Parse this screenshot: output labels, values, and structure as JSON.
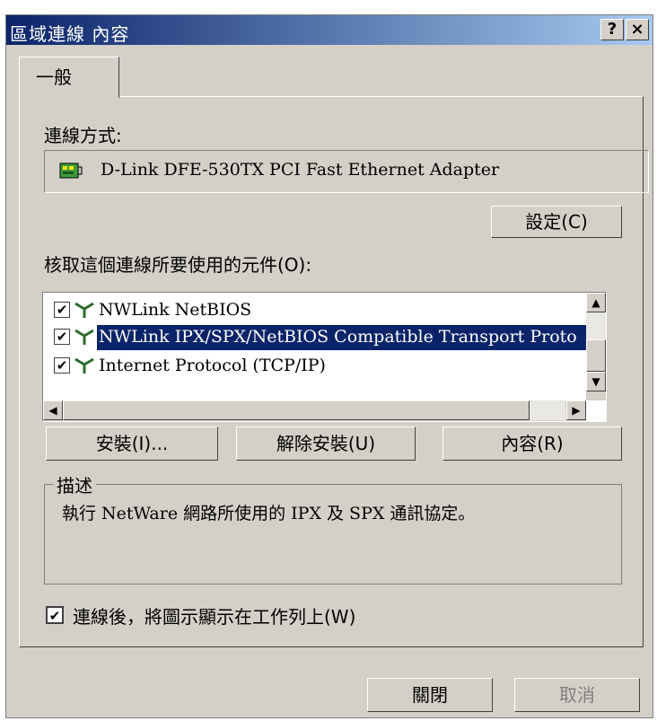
{
  "window": {
    "title": "區域連線 內容",
    "help_btn": "?",
    "close_btn": "×"
  },
  "tabs": [
    {
      "label": "一般"
    }
  ],
  "connect": {
    "label": "連線方式:",
    "adapter": "D-Link DFE-530TX PCI Fast Ethernet Adapter",
    "configure_btn": "設定(C)"
  },
  "components": {
    "label": "核取這個連線所要使用的元件(O):",
    "items": [
      {
        "name": "NWLink NetBIOS",
        "checked": true,
        "selected": false
      },
      {
        "name": "NWLink IPX/SPX/NetBIOS Compatible Transport Proto",
        "checked": true,
        "selected": true
      },
      {
        "name": "Internet Protocol (TCP/IP)",
        "checked": true,
        "selected": false
      }
    ]
  },
  "buttons": {
    "install": "安裝(I)...",
    "uninstall": "解除安裝(U)",
    "properties": "內容(R)"
  },
  "description": {
    "label": "描述",
    "text": "執行 NetWare 網路所使用的 IPX 及 SPX 通訊協定。"
  },
  "show_icon": {
    "label": "連線後，將圖示顯示在工作列上(W)",
    "checked": true
  },
  "footer": {
    "close": "關閉",
    "cancel": "取消"
  },
  "colors": {
    "title_start": "#0a246a",
    "title_end": "#a6caf0",
    "face": "#d4d0c8",
    "selection": "#0a246a"
  }
}
